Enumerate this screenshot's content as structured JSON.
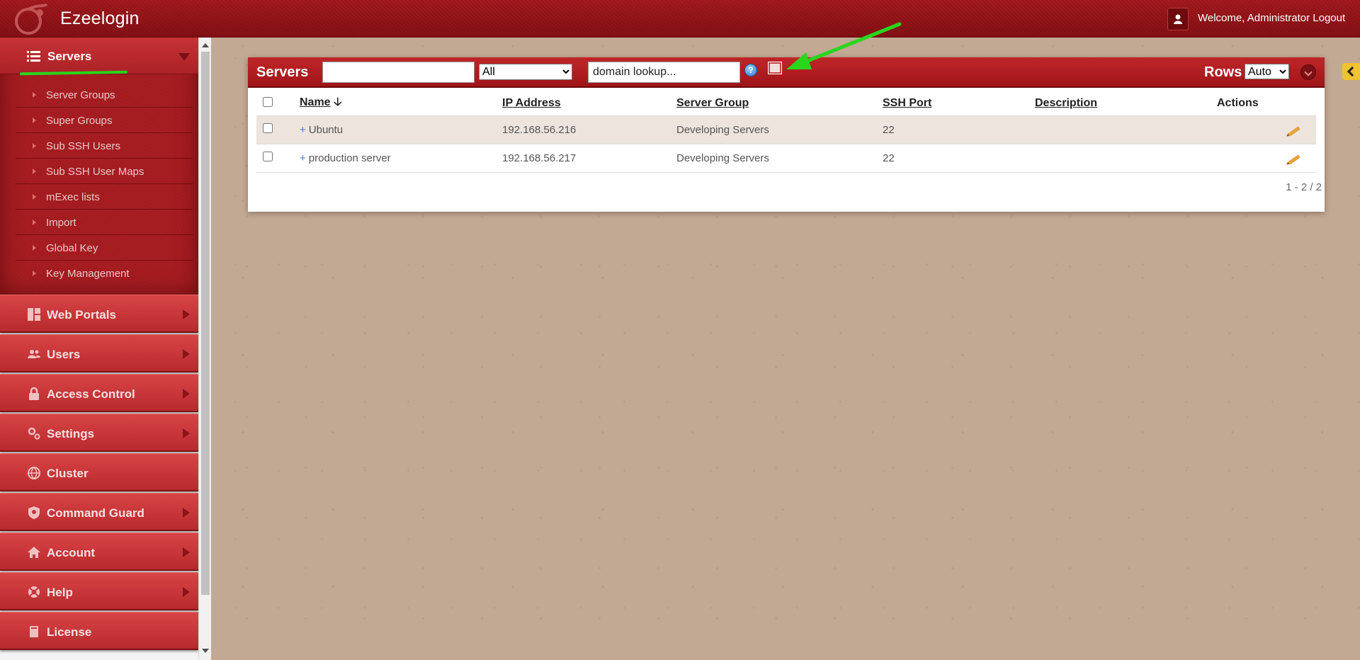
{
  "app": {
    "title": "Ezeelogin",
    "welcome_text": "Welcome, Administrator",
    "logout_label": "Logout"
  },
  "sidebar": {
    "servers": {
      "label": "Servers",
      "items": [
        {
          "label": "Server Groups"
        },
        {
          "label": "Super Groups"
        },
        {
          "label": "Sub SSH Users"
        },
        {
          "label": "Sub SSH User Maps"
        },
        {
          "label": "mExec lists"
        },
        {
          "label": "Import"
        },
        {
          "label": "Global Key"
        },
        {
          "label": "Key Management"
        }
      ]
    },
    "sections": [
      {
        "label": "Web Portals",
        "icon": "web-portals-icon"
      },
      {
        "label": "Users",
        "icon": "users-icon"
      },
      {
        "label": "Access Control",
        "icon": "lock-icon"
      },
      {
        "label": "Settings",
        "icon": "gears-icon"
      },
      {
        "label": "Cluster",
        "icon": "globe-icon"
      },
      {
        "label": "Command Guard",
        "icon": "shield-icon"
      },
      {
        "label": "Account",
        "icon": "home-icon"
      },
      {
        "label": "Help",
        "icon": "lifebuoy-icon"
      },
      {
        "label": "License",
        "icon": "license-icon"
      }
    ]
  },
  "panel": {
    "title": "Servers",
    "search_value": "",
    "group_filter": "All",
    "domain_lookup_value": "domain lookup...",
    "rows_label": "Rows",
    "rows_value": "Auto",
    "columns": [
      "Name",
      "IP Address",
      "Server Group",
      "SSH Port",
      "Description",
      "Actions"
    ],
    "rows": [
      {
        "name": "Ubuntu",
        "ip": "192.168.56.216",
        "group": "Developing Servers",
        "port": "22",
        "description": ""
      },
      {
        "name": "production server",
        "ip": "192.168.56.217",
        "group": "Developing Servers",
        "port": "22",
        "description": ""
      }
    ],
    "pager_text": "1 - 2 / 2"
  },
  "colors": {
    "header": "#9c161a",
    "sidebar_section": "#c8383b",
    "annotation": "#29d61c",
    "background": "#c2a993"
  }
}
